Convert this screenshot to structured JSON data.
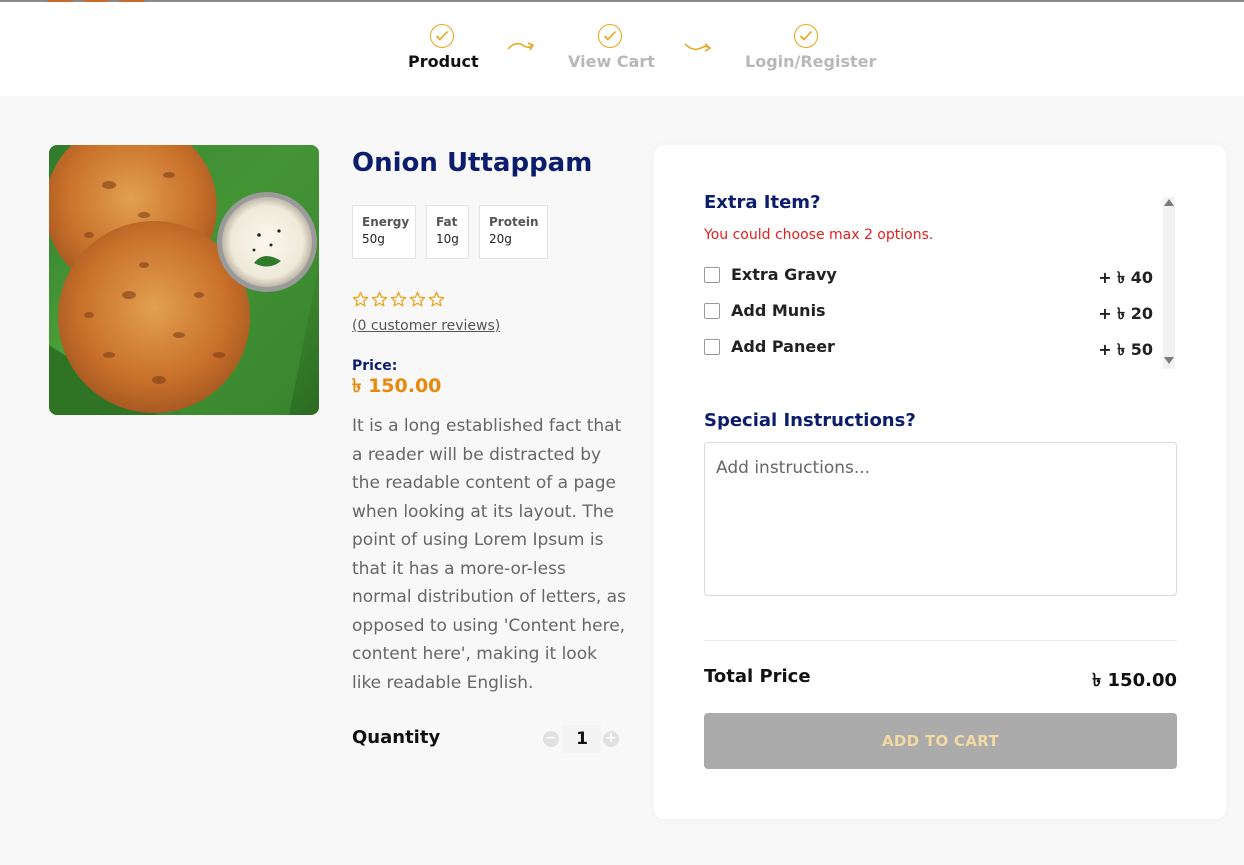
{
  "stepper": {
    "steps": [
      {
        "label": "Product"
      },
      {
        "label": "View Cart"
      },
      {
        "label": "Login/Register"
      }
    ]
  },
  "product": {
    "title": "Onion Uttappam",
    "nutrition": [
      {
        "name": "Energy",
        "value": "50g"
      },
      {
        "name": "Fat",
        "value": "10g"
      },
      {
        "name": "Protein",
        "value": "20g"
      }
    ],
    "rating": 0,
    "rating_max": 5,
    "reviews_link": "(0 customer reviews)",
    "price_label": "Price:",
    "price": "৳ 150.00",
    "description": "It is a long established fact that a reader will be distracted by the readable content of a page when looking at its layout. The point of using Lorem Ipsum is that it has a more-or-less normal distribution of letters, as opposed to using 'Content here, content here', making it look like readable English.",
    "quantity_label": "Quantity",
    "quantity": "1",
    "minus_glyph": "−",
    "plus_glyph": "+"
  },
  "extras": {
    "title": "Extra Item?",
    "note": "You could choose max 2 options.",
    "options": [
      {
        "name": "Extra Gravy",
        "price": "+ ৳ 40"
      },
      {
        "name": "Add Munis",
        "price": "+ ৳ 20"
      },
      {
        "name": "Add Paneer",
        "price": "+ ৳ 50"
      }
    ]
  },
  "special": {
    "title": "Special Instructions?",
    "placeholder": "Add instructions..."
  },
  "total": {
    "label": "Total Price",
    "value": "৳ 150.00"
  },
  "add_to_cart_label": "ADD TO CART",
  "colors": {
    "brand_blue": "#0b1d6b",
    "accent_orange": "#e8890c",
    "star_gold": "#e8a317",
    "error_red": "#e02020",
    "disabled_button": "#ababab"
  },
  "icons": {
    "step_done": "check-circle-icon",
    "step_arrow": "curved-arrow-icon",
    "star": "star-outline-icon"
  }
}
